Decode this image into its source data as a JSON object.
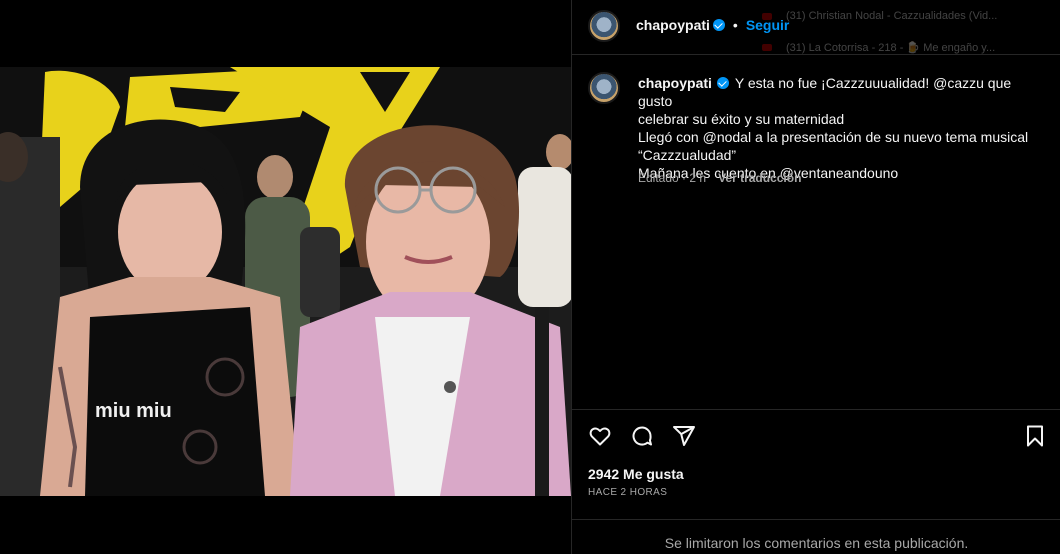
{
  "post": {
    "username": "chapoypati",
    "follow_label": "Seguir",
    "caption_lines": [
      "Y esta no fue ¡Cazzzuuualidad! @cazzu que gusto",
      "celebrar su éxito y su maternidad",
      "Llegó con @nodal a la presentación de su nuevo tema musical",
      "“Cazzzualudad”",
      "Mañana les cuento en @ventaneandouno"
    ],
    "edited_label": "Editado",
    "edited_time": "2 h",
    "translate_label": "Ver traducción",
    "likes_label": "2942 Me gusta",
    "posted_label": "HACE 2 HORAS",
    "comments_limited": "Se limitaron los comentarios en esta publicación."
  },
  "overlay": {
    "items": [
      "(31) Christian Nodal - Cazzualidades (Vid...",
      "(31) La Cotorrisa - 218 - 🍺 Me engaño y..."
    ]
  },
  "photo": {
    "shirt_text": "miu miu"
  },
  "colors": {
    "accent": "#0095f6",
    "background": "#000000",
    "muted": "#a8a8a8",
    "divider": "#262626"
  },
  "icons": [
    "heart-icon",
    "comment-icon",
    "share-icon",
    "bookmark-icon",
    "verified-icon"
  ]
}
